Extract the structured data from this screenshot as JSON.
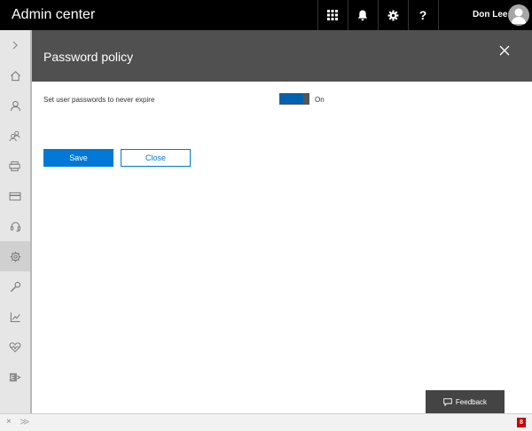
{
  "header": {
    "app_title": "Admin center",
    "user_name": "Don Lee",
    "icons": [
      "app-launcher-icon",
      "bell-icon",
      "gear-icon",
      "help-icon"
    ]
  },
  "nav": {
    "expand_icon": "chevron-right-icon",
    "items": [
      "home-icon",
      "user-icon",
      "groups-icon",
      "devices-icon",
      "billing-icon",
      "support-icon",
      "settings-icon",
      "setup-icon",
      "reports-icon",
      "health-icon",
      "exchange-icon"
    ],
    "active": "settings-icon"
  },
  "panel": {
    "title": "Password policy",
    "setting_label": "Set user passwords to never expire",
    "toggle_state": "On",
    "save_label": "Save",
    "close_label": "Close"
  },
  "feedback": {
    "label": "Feedback"
  },
  "bottombar": {
    "close_glyph": "×",
    "expand_glyph": "≫",
    "badge": "8"
  },
  "colors": {
    "topbar": "#000000",
    "panel_header": "#505050",
    "accent": "#0078d7",
    "toggle_on": "#0063b1",
    "nav_bg": "#e6e6e6"
  }
}
